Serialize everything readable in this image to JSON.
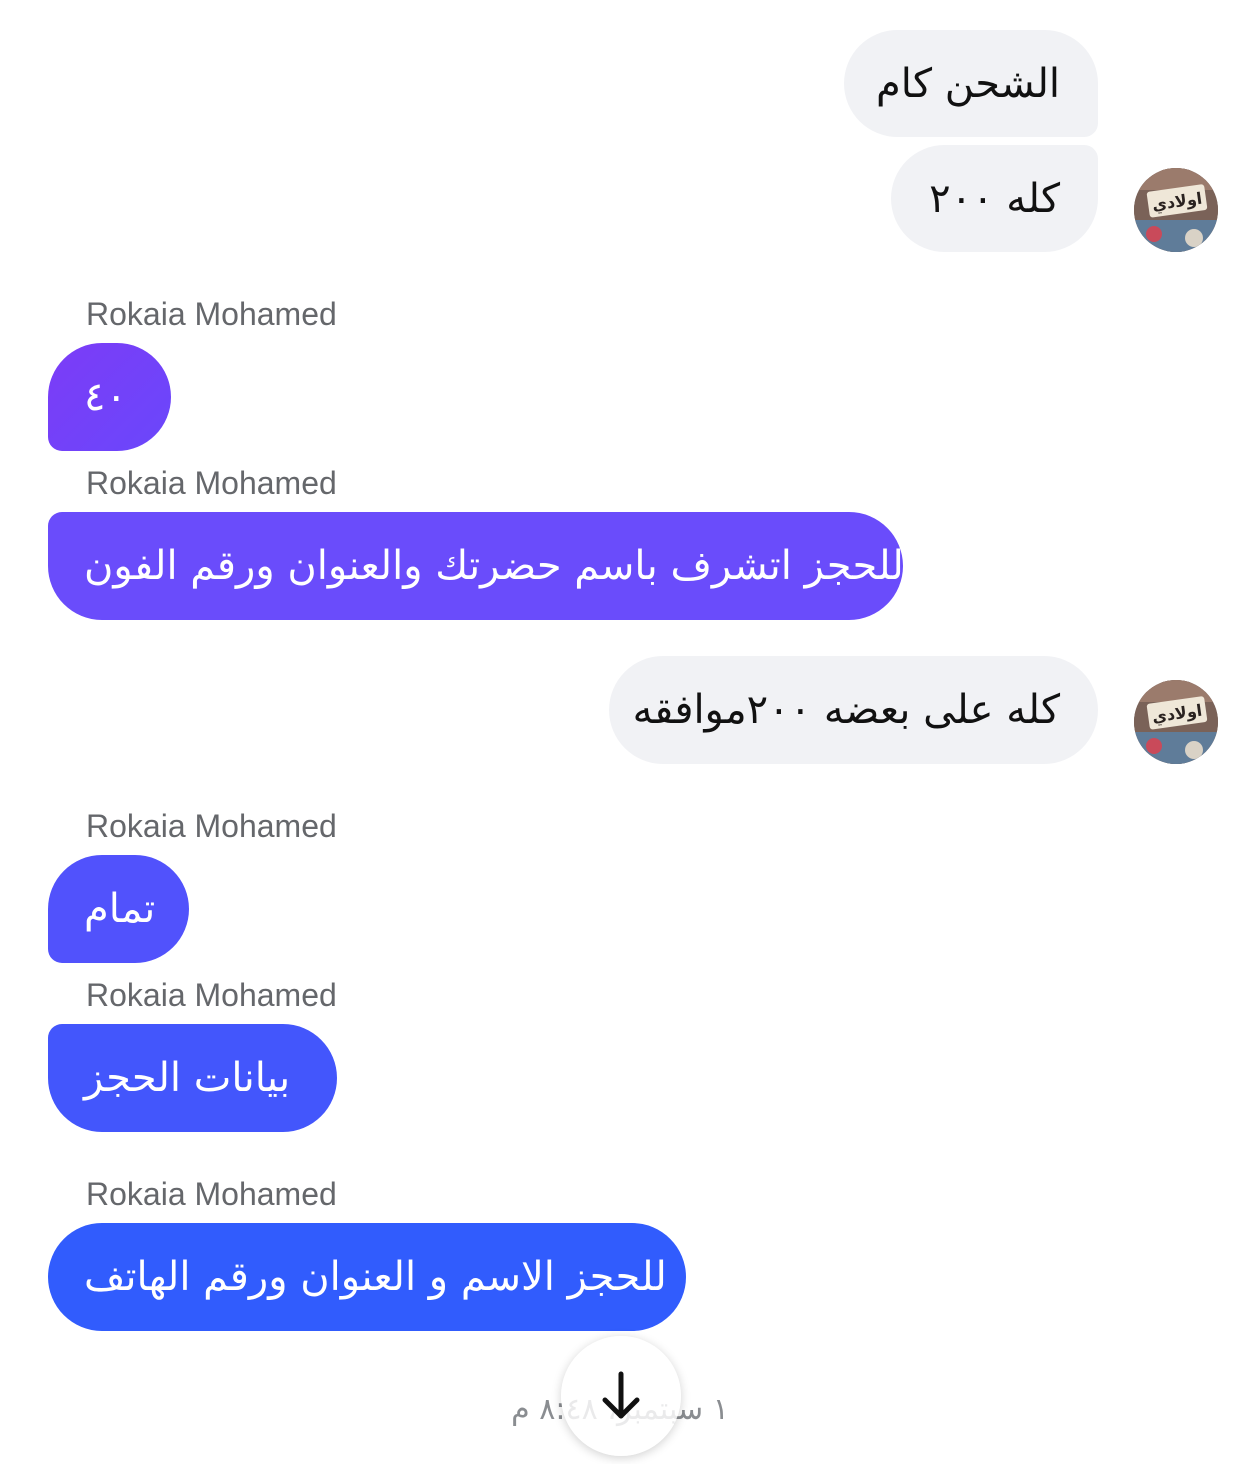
{
  "messages": {
    "m1": {
      "text": "الشحن كام"
    },
    "m2": {
      "text": "كله ٢٠٠"
    },
    "m3": {
      "sender": "Rokaia Mohamed",
      "text": "٤٠"
    },
    "m4": {
      "sender": "Rokaia Mohamed",
      "text": "للحجز اتشرف باسم حضرتك والعنوان ورقم الفون"
    },
    "m5": {
      "text": "كله على بعضه ٢٠٠موافقه"
    },
    "m6": {
      "sender": "Rokaia Mohamed",
      "text": "تمام"
    },
    "m7": {
      "sender": "Rokaia Mohamed",
      "text": "بيانات الحجز"
    },
    "m8": {
      "sender": "Rokaia Mohamed",
      "text": "للحجز الاسم و العنوان ورقم الهاتف"
    }
  },
  "avatar": {
    "label": "اولادي"
  },
  "footer": {
    "timestamp": "١ سبتمبر، ٨:٤٨ م"
  },
  "icons": {
    "scroll_down": "arrow-down-icon",
    "avatar": "contact-avatar"
  },
  "colors": {
    "outgoing_bg": "#f1f2f5",
    "incoming_gradient_top": "#7a43f7",
    "incoming_gradient_bottom": "#2f5cff",
    "sender_text": "#65676b"
  }
}
